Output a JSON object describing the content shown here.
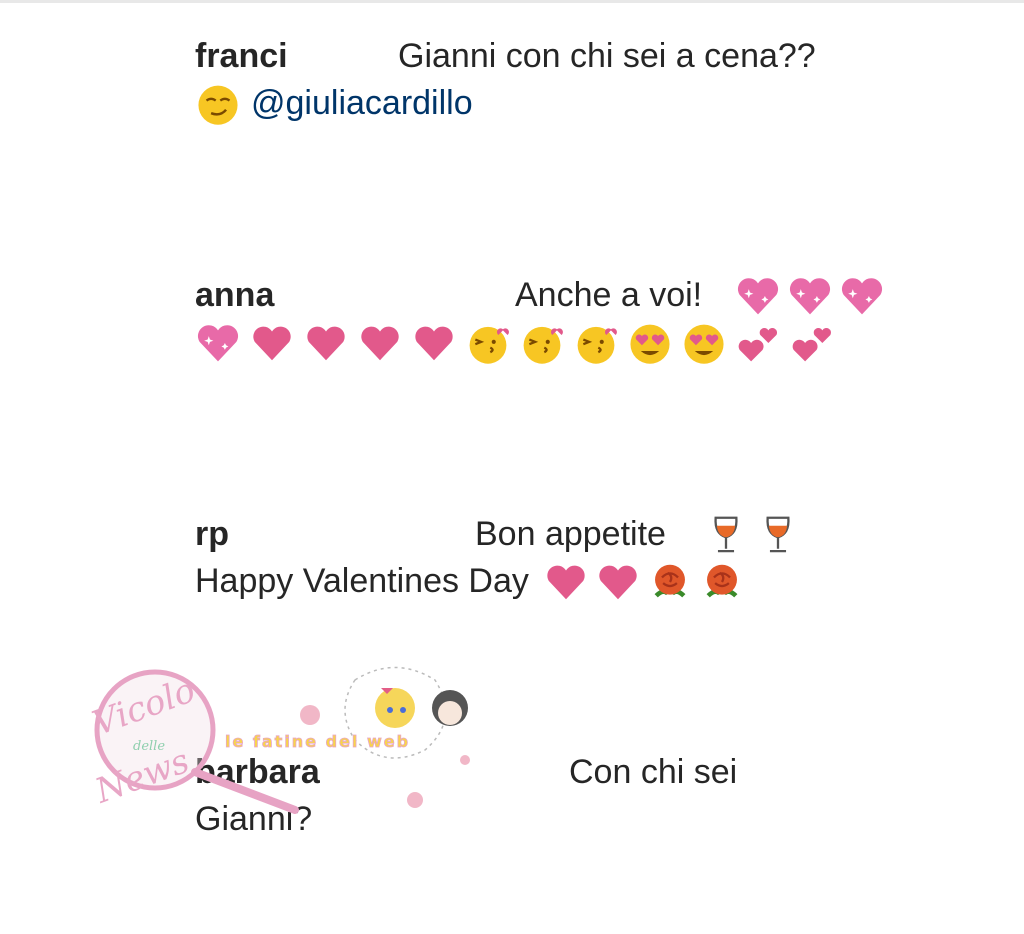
{
  "comments": [
    {
      "user": "franci",
      "text": "Gianni con chi sei a cena??",
      "mention": "@giulia­cardillo",
      "emoji_line1": [
        "smirk-face"
      ]
    },
    {
      "user": "anna",
      "text": "Anche a voi!"
    },
    {
      "user": "rp",
      "text": "Bon appetite",
      "text2": "Happy Valentines Day"
    },
    {
      "user": "barbara",
      "text": "Con chi sei",
      "text2": "Gianni?"
    }
  ],
  "watermark": {
    "brand": "Vicolo delle News",
    "sub": "le fatine del web"
  },
  "colors": {
    "mention": "#003569",
    "heart": "#e2598b",
    "sparkle_heart": "#e86aa8",
    "face": "#f7c623",
    "rose": "#e0572a",
    "wine": "#e86a28"
  }
}
